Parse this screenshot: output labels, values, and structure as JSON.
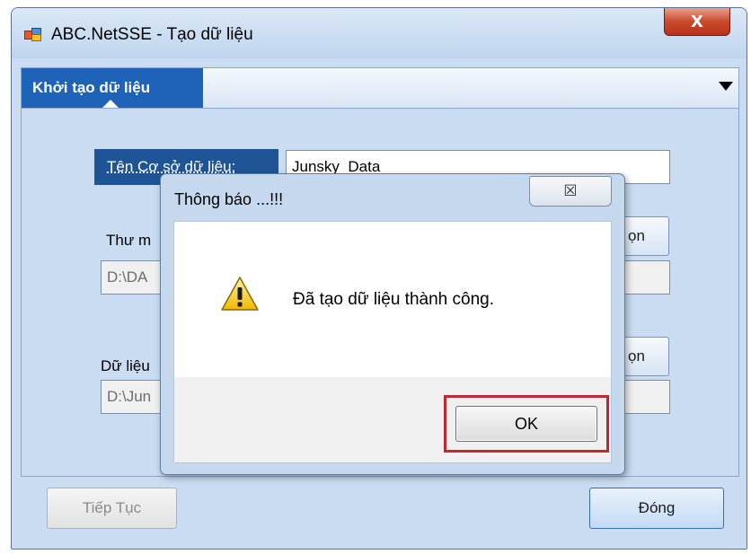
{
  "window": {
    "title": "ABC.NetSSE - Tạo dữ liệu",
    "close_glyph": "X",
    "app_icon": "app-icon"
  },
  "tabs": {
    "active_label": "Khởi tạo dữ liệu",
    "menu_icon": "chevron-down-icon"
  },
  "form": {
    "db_name_label": "Tên Cơ sở dữ liệu:",
    "db_name_value": "Junsky_Data",
    "folder_label": "Thư m",
    "folder_path": "D:\\DA",
    "folder_browse_label": "ọn",
    "data_label": "Dữ liệu",
    "data_path": "D:\\Jun",
    "data_browse_label": "ọn"
  },
  "footer": {
    "next_label": "Tiếp Tục",
    "close_label": "Đóng"
  },
  "dialog": {
    "title": "Thông báo ...!!!",
    "close_glyph": "☒",
    "icon": "warning-icon",
    "message": "Đã tạo dữ liệu thành công.",
    "ok_label": "OK"
  },
  "colors": {
    "tab_active": "#1e63b8",
    "highlight_frame": "#c0282f"
  }
}
